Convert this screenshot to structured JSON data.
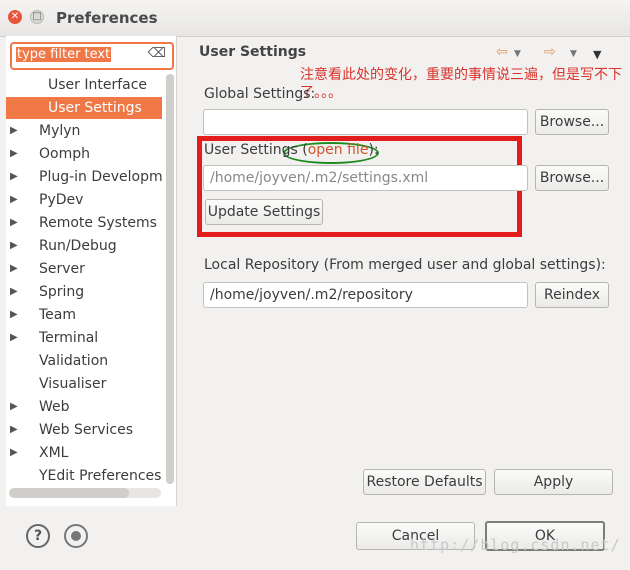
{
  "window": {
    "title": "Preferences"
  },
  "filter": {
    "placeholder": "type filter text"
  },
  "tree": [
    {
      "label": "User Interface",
      "child": true,
      "expandable": false
    },
    {
      "label": "User Settings",
      "child": true,
      "expandable": false,
      "selected": true
    },
    {
      "label": "Mylyn",
      "expandable": true
    },
    {
      "label": "Oomph",
      "expandable": true
    },
    {
      "label": "Plug-in Development",
      "expandable": true
    },
    {
      "label": "PyDev",
      "expandable": true
    },
    {
      "label": "Remote Systems",
      "expandable": true
    },
    {
      "label": "Run/Debug",
      "expandable": true
    },
    {
      "label": "Server",
      "expandable": true
    },
    {
      "label": "Spring",
      "expandable": true
    },
    {
      "label": "Team",
      "expandable": true
    },
    {
      "label": "Terminal",
      "expandable": true
    },
    {
      "label": "Validation",
      "expandable": false
    },
    {
      "label": "Visualiser",
      "expandable": false
    },
    {
      "label": "Web",
      "expandable": true
    },
    {
      "label": "Web Services",
      "expandable": true
    },
    {
      "label": "XML",
      "expandable": true
    },
    {
      "label": "YEdit Preferences",
      "expandable": false
    }
  ],
  "page": {
    "heading": "User Settings",
    "annotation": "注意看此处的变化，重要的事情说三遍，但是写不下了。。。",
    "global_label": "Global Settings:",
    "global_value": "",
    "browse_label": "Browse...",
    "user_label": "User Settings",
    "open_file": "open file",
    "user_value": "/home/joyven/.m2/settings.xml",
    "update_label": "Update Settings",
    "local_label": "Local Repository (From merged user and global settings):",
    "local_value": "/home/joyven/.m2/repository",
    "reindex_label": "Reindex",
    "restore_label": "Restore Defaults",
    "apply_label": "Apply"
  },
  "footer": {
    "cancel_label": "Cancel",
    "ok_label": "OK",
    "watermark": "http://blog.csdn.net/"
  },
  "colors": {
    "accent": "#f07746",
    "highlight_box": "#e31c1c",
    "ellipse": "#1c8a1c"
  }
}
